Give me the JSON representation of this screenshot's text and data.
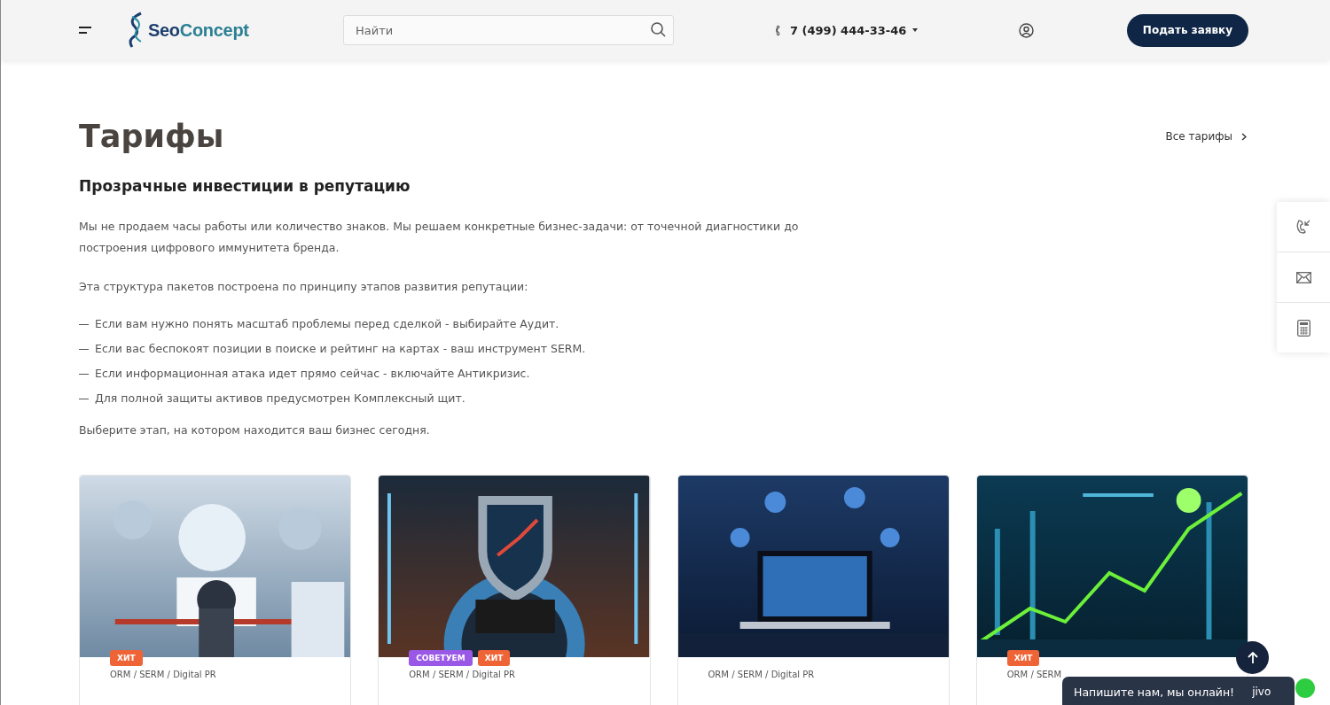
{
  "header": {
    "logo": {
      "first": "Seo",
      "second": "Concept"
    },
    "search": {
      "placeholder": "Найти"
    },
    "phone": "7 (499) 444-33-46",
    "cta": "Подать заявку"
  },
  "section": {
    "title": "Тарифы",
    "all_link": "Все тарифы",
    "subtitle": "Прозрачные инвестиции в репутацию",
    "intro": "Мы не продаем часы работы или количество знаков. Мы решаем конкретные бизнес-задачи: от точечной диагностики до построения цифрового иммунитета бренда.",
    "structure": "Эта структура пакетов построена по принципу этапов развития репутации:",
    "list": [
      "Если вам нужно понять масштаб проблемы перед сделкой - выбирайте Аудит.",
      "Если вас беспокоят позиции в поиске и рейтинг на картах - ваш инструмент SERM.",
      "Если информационная атака идет прямо сейчас - включайте Антикризис.",
      "Для полной защиты активов предусмотрен Комплексный щит."
    ],
    "outro": "Выберите этап, на котором находится ваш бизнес сегодня."
  },
  "cards": [
    {
      "badges": [
        {
          "label": "ХИТ",
          "kind": "hit"
        }
      ],
      "tags": "ORM / SERM / Digital PR"
    },
    {
      "badges": [
        {
          "label": "СОВЕТУЕМ",
          "kind": "recommend"
        },
        {
          "label": "ХИТ",
          "kind": "hit"
        }
      ],
      "tags": "ORM / SERM / Digital PR"
    },
    {
      "tags": "ORM / SERM / Digital PR"
    },
    {
      "badges": [
        {
          "label": "ХИТ",
          "kind": "hit"
        }
      ],
      "tags": "ORM / SERM"
    }
  ],
  "chat": {
    "text": "Напишите нам, мы онлайн!",
    "brand": "jivo"
  }
}
